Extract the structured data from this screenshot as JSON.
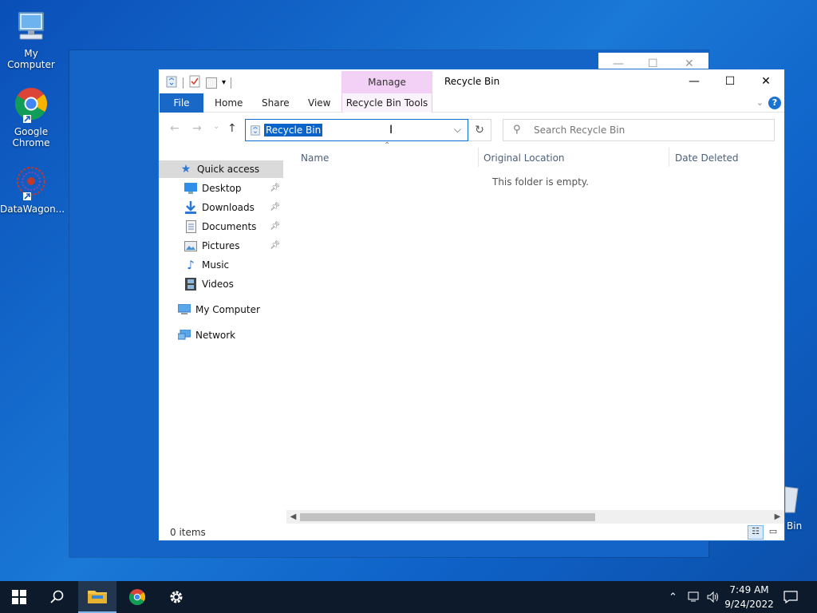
{
  "desktop": {
    "icons": [
      {
        "label": "My Computer"
      },
      {
        "label": "Google Chrome"
      },
      {
        "label": "DataWagon..."
      }
    ],
    "recycle_bin_peek": "Bin"
  },
  "window": {
    "title": "Recycle Bin",
    "contextual_group": "Manage",
    "controls": {
      "minimize": "—",
      "maximize": "☐",
      "close": "✕"
    }
  },
  "ribbon": {
    "tabs": [
      {
        "label": "File"
      },
      {
        "label": "Home"
      },
      {
        "label": "Share"
      },
      {
        "label": "View"
      },
      {
        "label": "Recycle Bin Tools"
      }
    ],
    "help": "?"
  },
  "navigation": {
    "back": "←",
    "forward": "→",
    "recent": "⌄",
    "up": "↑",
    "address_value": "Recycle Bin",
    "refresh": "↻",
    "search_placeholder": "Search Recycle Bin"
  },
  "sidebar": {
    "quick_access": "Quick access",
    "items": [
      {
        "label": "Desktop",
        "pinned": true
      },
      {
        "label": "Downloads",
        "pinned": true
      },
      {
        "label": "Documents",
        "pinned": true
      },
      {
        "label": "Pictures",
        "pinned": true
      },
      {
        "label": "Music",
        "pinned": false
      },
      {
        "label": "Videos",
        "pinned": false
      }
    ],
    "this_pc": "My Computer",
    "network": "Network"
  },
  "content": {
    "columns": [
      "Name",
      "Original Location",
      "Date Deleted"
    ],
    "empty_message": "This folder is empty."
  },
  "status": {
    "item_count": "0 items"
  },
  "taskbar": {
    "clock_time": "7:49 AM",
    "clock_date": "9/24/2022"
  },
  "colors": {
    "accent": "#1967c6",
    "selection": "#0a64c9",
    "manage_tab": "#f3d0f5",
    "taskbar": "#0c1a2b"
  }
}
